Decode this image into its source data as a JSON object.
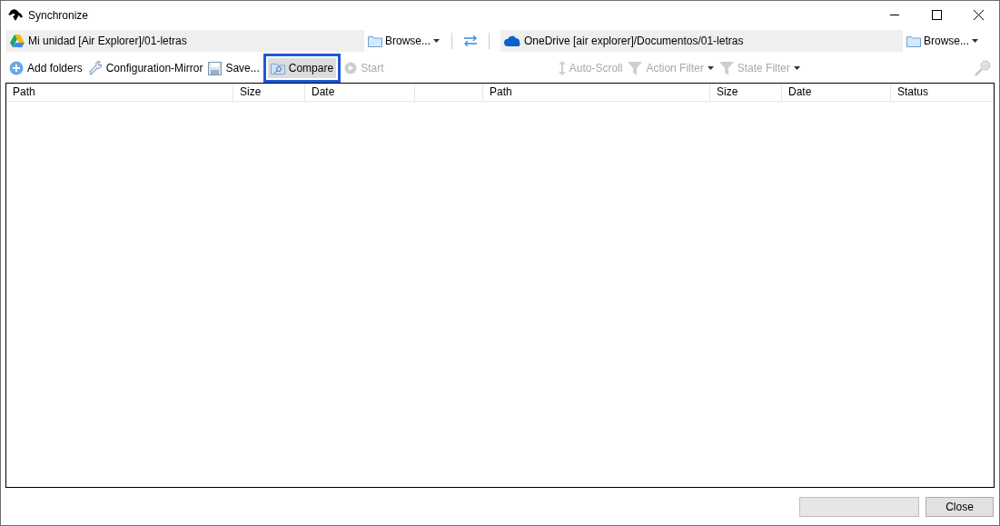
{
  "window": {
    "title": "Synchronize"
  },
  "sources": [
    {
      "kind": "gdrive",
      "path": "Mi unidad [Air Explorer]/01-letras",
      "browse": "Browse..."
    },
    {
      "kind": "onedrive",
      "path": "OneDrive [air explorer]/Documentos/01-letras",
      "browse": "Browse..."
    }
  ],
  "toolbar": [
    {
      "kind": "add",
      "label": "Add folders",
      "disabled": false,
      "highlighted": false,
      "dropdown": false
    },
    {
      "kind": "config",
      "label": "Configuration-Mirror",
      "disabled": false,
      "highlighted": false,
      "dropdown": false
    },
    {
      "kind": "save",
      "label": "Save...",
      "disabled": false,
      "highlighted": false,
      "dropdown": false
    },
    {
      "kind": "compare",
      "label": "Compare",
      "disabled": false,
      "highlighted": true,
      "dropdown": false
    },
    {
      "kind": "start",
      "label": "Start",
      "disabled": true,
      "highlighted": false,
      "dropdown": false
    },
    {
      "kind": "spacer"
    },
    {
      "kind": "scroll",
      "label": "Auto-Scroll",
      "disabled": true,
      "highlighted": false,
      "dropdown": false
    },
    {
      "kind": "filter",
      "label": "Action Filter",
      "disabled": true,
      "highlighted": false,
      "dropdown": true
    },
    {
      "kind": "filter",
      "label": "State Filter",
      "disabled": true,
      "highlighted": false,
      "dropdown": true
    },
    {
      "kind": "spacer"
    },
    {
      "kind": "search",
      "disabled": true,
      "highlighted": false,
      "dropdown": false
    }
  ],
  "table": {
    "columns": [
      "Path",
      "Size",
      "Date",
      null,
      "Path",
      "Size",
      "Date",
      "Status"
    ]
  },
  "buttons": [
    {
      "disabled": true
    },
    {
      "label": "Close",
      "disabled": false
    }
  ]
}
